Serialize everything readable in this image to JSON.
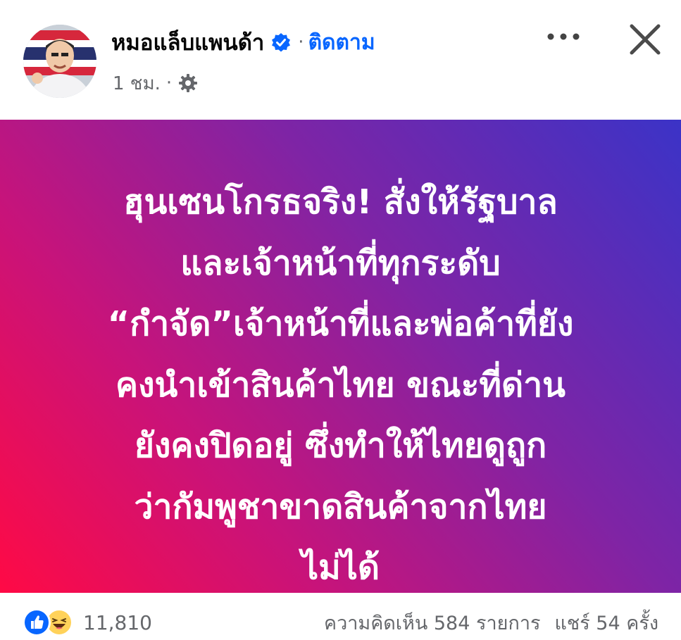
{
  "author": {
    "name": "หมอแล็บแพนด้า",
    "follow_label": "ติดตาม",
    "separator": "·"
  },
  "meta": {
    "time": "1 ชม.",
    "separator": "·"
  },
  "post": {
    "lines": [
      "ฮุนเซนโกรธจริง! สั่งให้รัฐบาล",
      "และเจ้าหน้าที่ทุกระดับ",
      "“กำจัด”เจ้าหน้าที่และพ่อค้าที่ยัง",
      "คงนำเข้าสินค้าไทย ขณะที่ด่าน",
      "ยังคงปิดอยู่ ซึ่งทำให้ไทยดูถูก",
      "ว่ากัมพูชาขาดสินค้าจากไทย",
      "ไม่ได้"
    ]
  },
  "footer": {
    "reaction_count": "11,810",
    "comments": "ความคิดเห็น 584 รายการ",
    "shares": "แชร์ 54 ครั้ง"
  },
  "icons": {
    "verified": "verified-badge-icon",
    "privacy": "gear-icon",
    "more": "more-icon",
    "close": "close-icon",
    "like": "like-reaction-icon",
    "haha": "haha-reaction-icon"
  },
  "colors": {
    "accent": "#0866ff",
    "muted": "#65676b",
    "gradient_start": "#ff0a45",
    "gradient_end": "#3b33c7"
  }
}
